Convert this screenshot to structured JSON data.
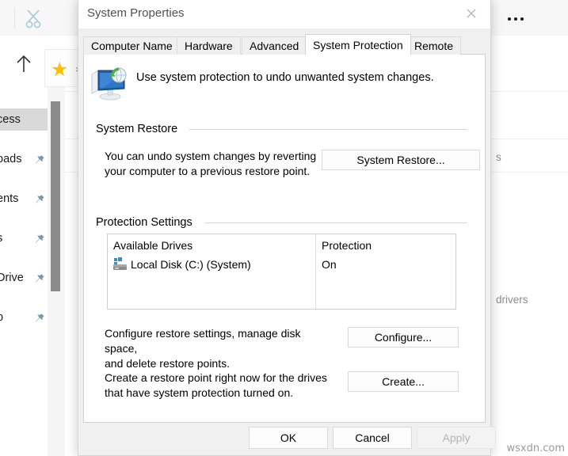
{
  "explorer": {
    "toolbar": {
      "cut_icon": "scissors-icon",
      "overflow_icon": "ellipsis-icon"
    },
    "nav": {
      "up_icon": "up-arrow-icon",
      "star_icon": "star-icon",
      "close_glyph": "×"
    },
    "sidebar_items": [
      {
        "label": "cess",
        "pinned": false,
        "selected": true
      },
      {
        "label": "oads",
        "pinned": true,
        "selected": false
      },
      {
        "label": "ents",
        "pinned": true,
        "selected": false
      },
      {
        "label": "s",
        "pinned": true,
        "selected": false
      },
      {
        "label": "Drive",
        "pinned": true,
        "selected": false
      },
      {
        "label": "p",
        "pinned": true,
        "selected": false
      }
    ],
    "content_texts": [
      {
        "text": "s"
      },
      {
        "text": "drivers"
      }
    ],
    "watermark": "wsxdn.com"
  },
  "dialog": {
    "title": "System Properties",
    "close_label": "✕",
    "tabs": [
      {
        "label": "Computer Name",
        "active": false
      },
      {
        "label": "Hardware",
        "active": false
      },
      {
        "label": "Advanced",
        "active": false
      },
      {
        "label": "System Protection",
        "active": true
      },
      {
        "label": "Remote",
        "active": false
      }
    ],
    "header": {
      "icon": "system-protection-icon",
      "text": "Use system protection to undo unwanted system changes."
    },
    "system_restore": {
      "group_label": "System Restore",
      "description": "You can undo system changes by reverting\nyour computer to a previous restore point.",
      "button_label": "System Restore..."
    },
    "protection_settings": {
      "group_label": "Protection Settings",
      "columns": [
        "Available Drives",
        "Protection"
      ],
      "rows": [
        {
          "drive_icon": "local-disk-icon",
          "drive": "Local Disk (C:) (System)",
          "protection": "On"
        }
      ],
      "configure": {
        "description": "Configure restore settings, manage disk space,\nand delete restore points.",
        "button_label": "Configure..."
      },
      "create": {
        "description": "Create a restore point right now for the drives\nthat have system protection turned on.",
        "button_label": "Create..."
      }
    },
    "footer": {
      "ok_label": "OK",
      "cancel_label": "Cancel",
      "apply_label": "Apply",
      "apply_disabled": true
    }
  },
  "colors": {
    "dialog_bg": "#f0f0f0",
    "panel_bg": "#ffffff",
    "star": "#ffc000",
    "cut_icon": "#a9cbe0",
    "pin": "#7a98ab",
    "disabled_text": "#b5b5b5"
  }
}
